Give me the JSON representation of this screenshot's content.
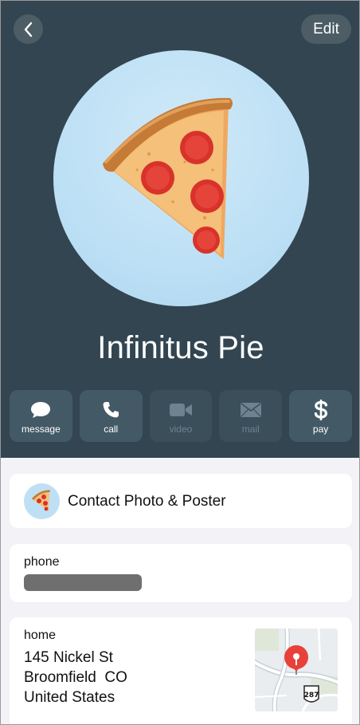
{
  "header": {
    "edit_label": "Edit",
    "contact_name": "Infinitus Pie",
    "avatar_emoji": "pizza-slice",
    "background_color": "#324550"
  },
  "actions": [
    {
      "label": "message",
      "icon": "speech-bubble-icon",
      "enabled": true
    },
    {
      "label": "call",
      "icon": "phone-icon",
      "enabled": true
    },
    {
      "label": "video",
      "icon": "video-camera-icon",
      "enabled": false
    },
    {
      "label": "mail",
      "icon": "envelope-icon",
      "enabled": false
    },
    {
      "label": "pay",
      "icon": "dollar-icon",
      "enabled": true
    }
  ],
  "poster_card": {
    "label": "Contact Photo & Poster"
  },
  "phone_card": {
    "label": "phone",
    "value_redacted": true
  },
  "address_card": {
    "label": "home",
    "line1": "145 Nickel St",
    "line2": "Broomfield  CO",
    "line3": "United States",
    "map_shield": "287"
  }
}
